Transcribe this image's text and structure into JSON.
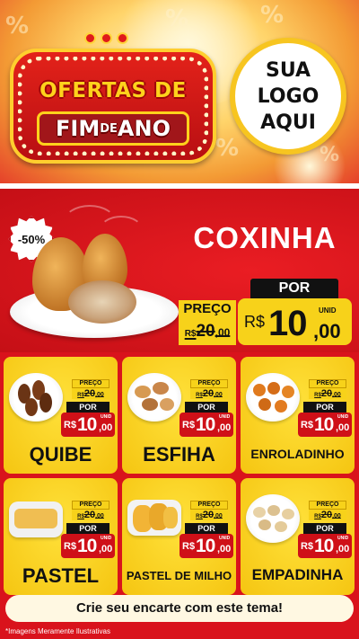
{
  "header": {
    "title_line1": "OFERTAS DE",
    "title_fim": "FIM",
    "title_de": "DE",
    "title_ano": "ANO",
    "logo_line1": "SUA",
    "logo_line2": "LOGO",
    "logo_line3": "AQUI"
  },
  "hero": {
    "discount": "-50%",
    "title": "COXINHA",
    "old_label": "PREÇO",
    "old_currency": "R$",
    "old_int": "20",
    "old_cents": ",00",
    "new_label": "POR",
    "new_currency": "R$",
    "new_int": "10",
    "new_cents": ",00",
    "unit": "UNID"
  },
  "products": [
    {
      "name": "QUIBE",
      "old_label": "PREÇO",
      "old_currency": "R$",
      "old_int": "20",
      "old_cents": ",00",
      "new_label": "POR",
      "new_currency": "R$",
      "new_int": "10",
      "new_cents": ",00",
      "unit": "UNID"
    },
    {
      "name": "ESFIHA",
      "old_label": "PREÇO",
      "old_currency": "R$",
      "old_int": "20",
      "old_cents": ",00",
      "new_label": "POR",
      "new_currency": "R$",
      "new_int": "10",
      "new_cents": ",00",
      "unit": "UNID"
    },
    {
      "name": "ENROLADINHO",
      "old_label": "PREÇO",
      "old_currency": "R$",
      "old_int": "20",
      "old_cents": ",00",
      "new_label": "POR",
      "new_currency": "R$",
      "new_int": "10",
      "new_cents": ",00",
      "unit": "UNID"
    },
    {
      "name": "PASTEL",
      "old_label": "PREÇO",
      "old_currency": "R$",
      "old_int": "20",
      "old_cents": ",00",
      "new_label": "POR",
      "new_currency": "R$",
      "new_int": "10",
      "new_cents": ",00",
      "unit": "UNID"
    },
    {
      "name": "PASTEL DE MILHO",
      "old_label": "PREÇO",
      "old_currency": "R$",
      "old_int": "20",
      "old_cents": ",00",
      "new_label": "POR",
      "new_currency": "R$",
      "new_int": "10",
      "new_cents": ",00",
      "unit": "UNID"
    },
    {
      "name": "EMPADINHA",
      "old_label": "PREÇO",
      "old_currency": "R$",
      "old_int": "20",
      "old_cents": ",00",
      "new_label": "POR",
      "new_currency": "R$",
      "new_int": "10",
      "new_cents": ",00",
      "unit": "UNID"
    }
  ],
  "cta": "Crie seu encarte com este tema!",
  "disclaimer": "*Imagens Meramente Ilustrativas",
  "colors": {
    "background_red": "#d9131c",
    "price_yellow": "#f7d21a",
    "card_yellow": "#ffe13a",
    "badge_black": "#111111"
  },
  "icons": [
    "star-bulb-icon",
    "percent-deco-icon",
    "burst-badge-icon"
  ]
}
